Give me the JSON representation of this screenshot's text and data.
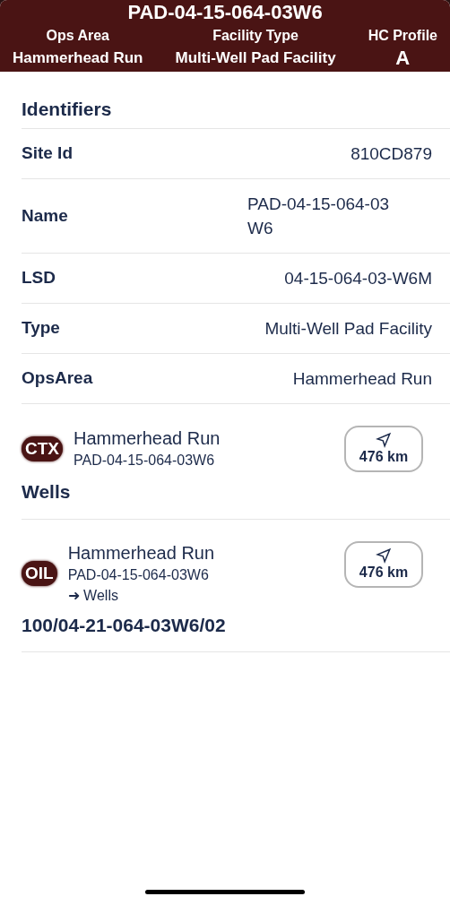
{
  "header": {
    "title": "PAD-04-15-064-03W6",
    "columns": [
      {
        "label": "Ops Area",
        "value": "Hammerhead Run"
      },
      {
        "label": "Facility Type",
        "value": "Multi-Well Pad Facility"
      },
      {
        "label": "HC Profile",
        "value": "A"
      }
    ]
  },
  "identifiers": {
    "heading": "Identifiers",
    "rows": [
      {
        "label": "Site Id",
        "value": "810CD879"
      },
      {
        "label": "Name",
        "value": "PAD-04-15-064-03\nW6"
      },
      {
        "label": "LSD",
        "value": "04-15-064-03-W6M"
      },
      {
        "label": "Type",
        "value": "Multi-Well Pad Facility"
      },
      {
        "label": "OpsArea",
        "value": "Hammerhead Run"
      }
    ]
  },
  "items": [
    {
      "badge": "CTX",
      "title": "Hammerhead Run",
      "subtitle": "PAD-04-15-064-03W6",
      "distance": "476 km",
      "footer": "Wells"
    },
    {
      "badge": "OIL",
      "title": "Hammerhead Run",
      "subtitle": "PAD-04-15-064-03W6",
      "link": "➜ Wells",
      "distance": "476 km",
      "footer": "100/04-21-064-03W6/02"
    }
  ]
}
